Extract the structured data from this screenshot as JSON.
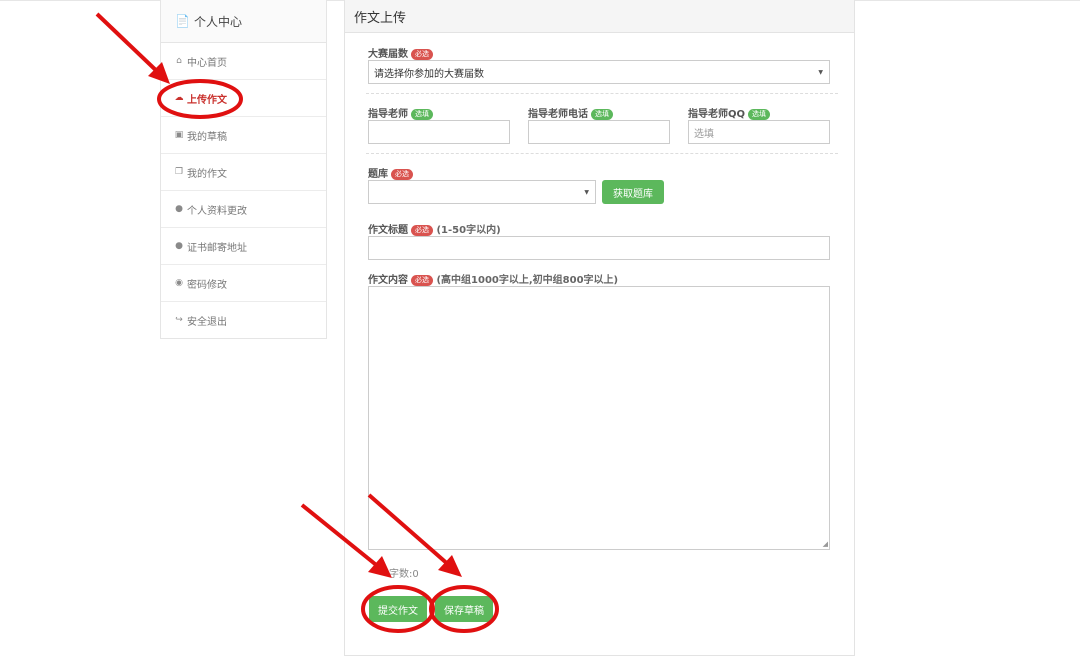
{
  "sidebar": {
    "title": "个人中心",
    "title_icon": "document-icon",
    "items": [
      {
        "label": "中心首页",
        "icon": "home-icon",
        "active": false
      },
      {
        "label": "上传作文",
        "icon": "cloud-upload-icon",
        "active": true
      },
      {
        "label": "我的草稿",
        "icon": "draft-icon",
        "active": false
      },
      {
        "label": "我的作文",
        "icon": "copy-icon",
        "active": false
      },
      {
        "label": "个人资料更改",
        "icon": "user-icon",
        "active": false
      },
      {
        "label": "证书邮寄地址",
        "icon": "user-icon",
        "active": false
      },
      {
        "label": "密码修改",
        "icon": "comment-icon",
        "active": false
      },
      {
        "label": "安全退出",
        "icon": "sign-out-icon",
        "active": false
      }
    ]
  },
  "panel": {
    "title": "作文上传"
  },
  "badges": {
    "required": "必选",
    "optional": "选填"
  },
  "form": {
    "session": {
      "label": "大赛届数",
      "value": "请选择你参加的大赛届数"
    },
    "teacher": {
      "label": "指导老师",
      "value": ""
    },
    "teacher_phone": {
      "label": "指导老师电话",
      "value": ""
    },
    "teacher_qq": {
      "label": "指导老师QQ",
      "placeholder": "选填",
      "value": ""
    },
    "question_bank": {
      "label": "题库",
      "value": "",
      "fetch_button": "获取题库"
    },
    "essay_title": {
      "label": "作文标题",
      "note": "(1-50字以内)",
      "value": ""
    },
    "essay_content": {
      "label": "作文内容",
      "note": "(高中组1000字以上,初中组800字以上)",
      "value": ""
    },
    "word_count": "字数:0"
  },
  "actions": {
    "submit": "提交作文",
    "save_draft": "保存草稿"
  },
  "colors": {
    "accent_green": "#5cb85c",
    "required_red": "#d9534f",
    "annotation_red": "#e01010"
  }
}
